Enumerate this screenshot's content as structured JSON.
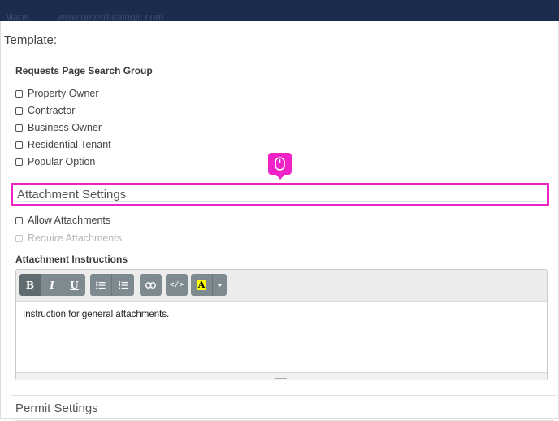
{
  "topbar": {
    "items": [
      "Maps",
      "www.gevisdatalogic.com"
    ]
  },
  "template": {
    "title": "Template:"
  },
  "requests_group": {
    "label": "Requests Page Search Group",
    "options": [
      {
        "label": "Property Owner",
        "checked": false
      },
      {
        "label": "Contractor",
        "checked": false
      },
      {
        "label": "Business Owner",
        "checked": false
      },
      {
        "label": "Residential Tenant",
        "checked": false
      },
      {
        "label": "Popular Option",
        "checked": false
      }
    ]
  },
  "attachment_settings": {
    "title": "Attachment Settings",
    "highlight_color": "#ee22c6",
    "allow_label": "Allow Attachments",
    "require_label": "Require Attachments",
    "instructions_label": "Attachment Instructions",
    "instructions_text": "Instruction for general attachments."
  },
  "toolbar": {
    "bold": "B",
    "italic": "I",
    "underline": "U",
    "color_letter": "A",
    "icons": [
      "bold-icon",
      "italic-icon",
      "underline-icon",
      "bullet-list-icon",
      "numbered-list-icon",
      "link-icon",
      "code-view-icon",
      "text-color-icon",
      "dropdown-caret-icon"
    ],
    "code": "</>"
  },
  "permit_settings": {
    "title": "Permit Settings"
  }
}
